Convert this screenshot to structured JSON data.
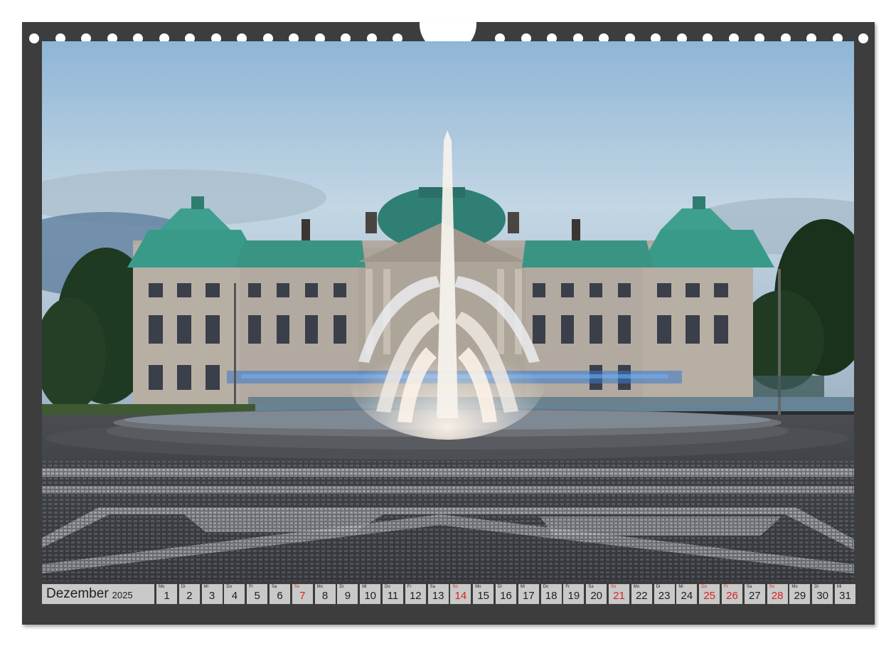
{
  "calendar": {
    "month": "Dezember",
    "year": "2025",
    "days": [
      {
        "wd": "Mo",
        "num": "1",
        "red": false
      },
      {
        "wd": "Di",
        "num": "2",
        "red": false
      },
      {
        "wd": "Mi",
        "num": "3",
        "red": false
      },
      {
        "wd": "Do",
        "num": "4",
        "red": false
      },
      {
        "wd": "Fr",
        "num": "5",
        "red": false
      },
      {
        "wd": "Sa",
        "num": "6",
        "red": false
      },
      {
        "wd": "So",
        "num": "7",
        "red": true
      },
      {
        "wd": "Mo",
        "num": "8",
        "red": false
      },
      {
        "wd": "Di",
        "num": "9",
        "red": false
      },
      {
        "wd": "Mi",
        "num": "10",
        "red": false
      },
      {
        "wd": "Do",
        "num": "11",
        "red": false
      },
      {
        "wd": "Fr",
        "num": "12",
        "red": false
      },
      {
        "wd": "Sa",
        "num": "13",
        "red": false
      },
      {
        "wd": "So",
        "num": "14",
        "red": true
      },
      {
        "wd": "Mo",
        "num": "15",
        "red": false
      },
      {
        "wd": "Di",
        "num": "16",
        "red": false
      },
      {
        "wd": "Mi",
        "num": "17",
        "red": false
      },
      {
        "wd": "Do",
        "num": "18",
        "red": false
      },
      {
        "wd": "Fr",
        "num": "19",
        "red": false
      },
      {
        "wd": "Sa",
        "num": "20",
        "red": false
      },
      {
        "wd": "So",
        "num": "21",
        "red": true
      },
      {
        "wd": "Mo",
        "num": "22",
        "red": false
      },
      {
        "wd": "Di",
        "num": "23",
        "red": false
      },
      {
        "wd": "Mi",
        "num": "24",
        "red": false
      },
      {
        "wd": "Do",
        "num": "25",
        "red": true
      },
      {
        "wd": "Fr",
        "num": "26",
        "red": true
      },
      {
        "wd": "Sa",
        "num": "27",
        "red": false
      },
      {
        "wd": "So",
        "num": "28",
        "red": true
      },
      {
        "wd": "Mo",
        "num": "29",
        "red": false
      },
      {
        "wd": "Di",
        "num": "30",
        "red": false
      },
      {
        "wd": "Mi",
        "num": "31",
        "red": false
      }
    ]
  },
  "colors": {
    "frame": "#3d3d3d",
    "cell": "#c9c9c9",
    "holiday_red": "#d9231e",
    "roof_copper": "#3a9a8a"
  }
}
